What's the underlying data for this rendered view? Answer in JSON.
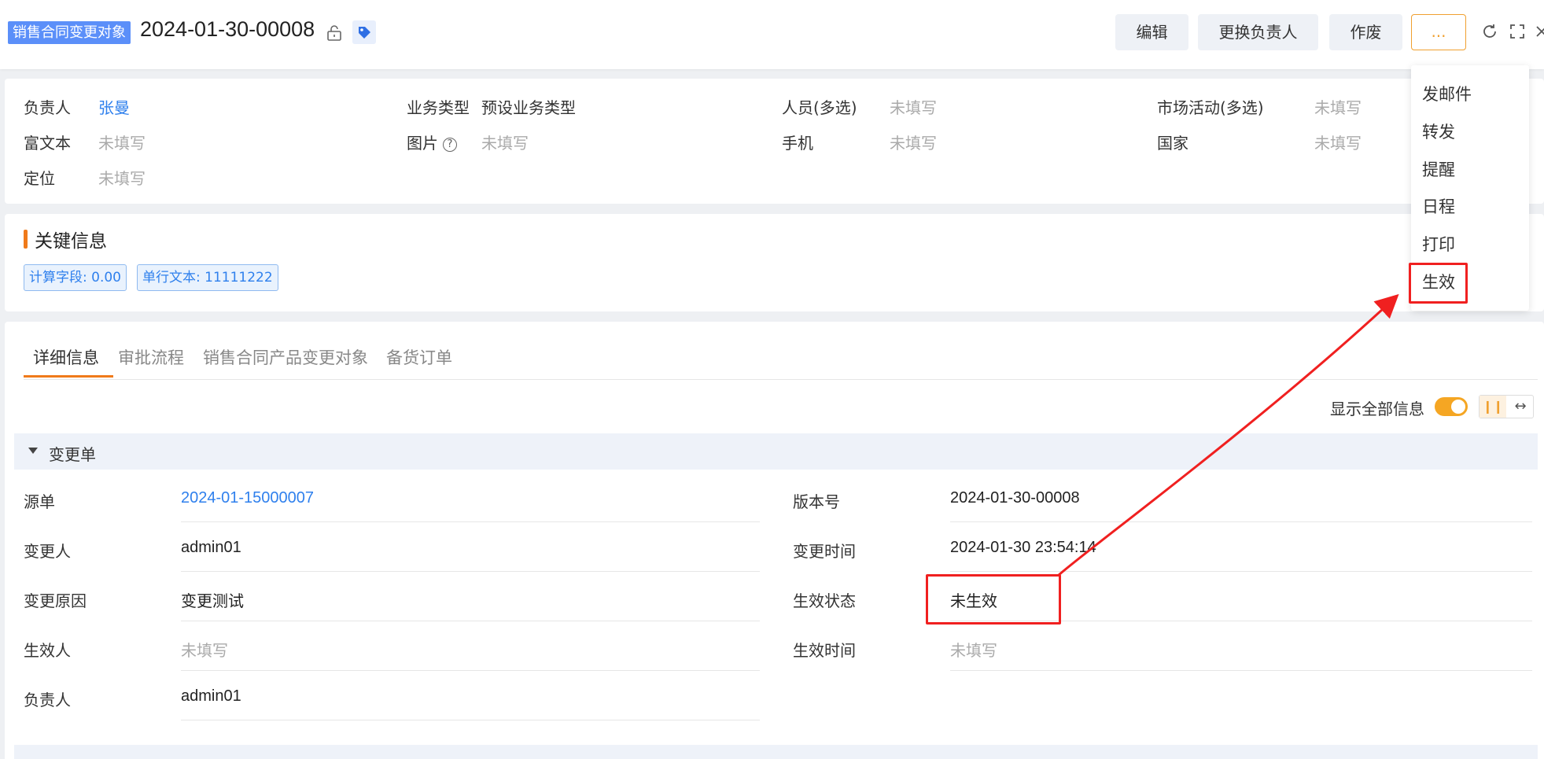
{
  "header": {
    "object_tag": "销售合同变更对象",
    "record_no": "2024-01-30-00008",
    "buttons": {
      "edit": "编辑",
      "change_owner": "更换负责人",
      "void": "作废",
      "more": "..."
    }
  },
  "summary": {
    "owner_label": "负责人",
    "owner_value": "张曼",
    "biz_type_label": "业务类型",
    "biz_type_value": "预设业务类型",
    "staff_label": "人员(多选)",
    "staff_value": "未填写",
    "campaign_label": "市场活动(多选)",
    "campaign_value": "未填写",
    "richtext_label": "富文本",
    "richtext_value": "未填写",
    "image_label": "图片",
    "image_value": "未填写",
    "mobile_label": "手机",
    "mobile_value": "未填写",
    "country_label": "国家",
    "country_value": "未填写",
    "location_label": "定位",
    "location_value": "未填写"
  },
  "key_info": {
    "title": "关键信息",
    "chips": [
      "计算字段: 0.00",
      "单行文本: 11111222"
    ]
  },
  "tabs": [
    "详细信息",
    "审批流程",
    "销售合同产品变更对象",
    "备货订单"
  ],
  "detail": {
    "show_all_label": "显示全部信息",
    "section_title": "变更单",
    "fields": {
      "source_label": "源单",
      "source_value": "2024-01-15000007",
      "version_label": "版本号",
      "version_value": "2024-01-30-00008",
      "changer_label": "变更人",
      "changer_value": "admin01",
      "change_time_label": "变更时间",
      "change_time_value": "2024-01-30 23:54:14",
      "reason_label": "变更原因",
      "reason_value": "变更测试",
      "status_label": "生效状态",
      "status_value": "未生效",
      "effector_label": "生效人",
      "effector_value": "未填写",
      "effect_time_label": "生效时间",
      "effect_time_value": "未填写",
      "owner_label": "负责人",
      "owner_value": "admin01"
    }
  },
  "more_menu": [
    "发邮件",
    "转发",
    "提醒",
    "日程",
    "打印",
    "生效"
  ],
  "colors": {
    "accent": "#f07a1a",
    "link": "#2f80ed",
    "annotation": "#f02020",
    "tag_bg": "#5b8ff9"
  }
}
